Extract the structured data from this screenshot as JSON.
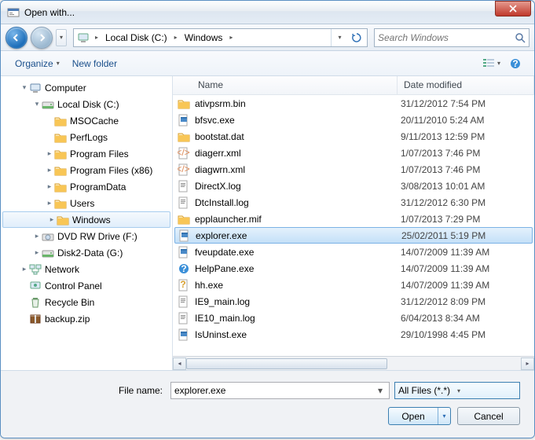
{
  "title": "Open with...",
  "breadcrumb": {
    "seg0": "Local Disk (C:)",
    "seg1": "Windows"
  },
  "search": {
    "placeholder": "Search Windows"
  },
  "toolbar": {
    "organize": "Organize",
    "newfolder": "New folder"
  },
  "tree": [
    {
      "depth": 1,
      "exp": "▾",
      "icon": "computer",
      "label": "Computer"
    },
    {
      "depth": 2,
      "exp": "▾",
      "icon": "drive",
      "label": "Local Disk (C:)"
    },
    {
      "depth": 3,
      "exp": "",
      "icon": "folder",
      "label": "MSOCache"
    },
    {
      "depth": 3,
      "exp": "",
      "icon": "folder",
      "label": "PerfLogs"
    },
    {
      "depth": 3,
      "exp": "▸",
      "icon": "folder",
      "label": "Program Files"
    },
    {
      "depth": 3,
      "exp": "▸",
      "icon": "folder",
      "label": "Program Files (x86)"
    },
    {
      "depth": 3,
      "exp": "▸",
      "icon": "folder",
      "label": "ProgramData"
    },
    {
      "depth": 3,
      "exp": "▸",
      "icon": "folder",
      "label": "Users"
    },
    {
      "depth": 3,
      "exp": "▸",
      "icon": "folder",
      "label": "Windows",
      "selected": true
    },
    {
      "depth": 2,
      "exp": "▸",
      "icon": "dvd",
      "label": "DVD RW Drive (F:)"
    },
    {
      "depth": 2,
      "exp": "▸",
      "icon": "drive",
      "label": "Disk2-Data (G:)"
    },
    {
      "depth": 1,
      "exp": "▸",
      "icon": "network",
      "label": "Network"
    },
    {
      "depth": 1,
      "exp": "",
      "icon": "control",
      "label": "Control Panel"
    },
    {
      "depth": 1,
      "exp": "",
      "icon": "recycle",
      "label": "Recycle Bin"
    },
    {
      "depth": 1,
      "exp": "",
      "icon": "zip",
      "label": "backup.zip"
    }
  ],
  "columns": {
    "name": "Name",
    "date": "Date modified"
  },
  "files": [
    {
      "icon": "file",
      "name": "ativpsrm.bin",
      "date": "31/12/2012 7:54 PM"
    },
    {
      "icon": "exe",
      "name": "bfsvc.exe",
      "date": "20/11/2010 5:24 AM"
    },
    {
      "icon": "file",
      "name": "bootstat.dat",
      "date": "9/11/2013 12:59 PM"
    },
    {
      "icon": "xml",
      "name": "diagerr.xml",
      "date": "1/07/2013 7:46 PM"
    },
    {
      "icon": "xml",
      "name": "diagwrn.xml",
      "date": "1/07/2013 7:46 PM"
    },
    {
      "icon": "log",
      "name": "DirectX.log",
      "date": "3/08/2013 10:01 AM"
    },
    {
      "icon": "log",
      "name": "DtcInstall.log",
      "date": "31/12/2012 6:30 PM"
    },
    {
      "icon": "file",
      "name": "epplauncher.mif",
      "date": "1/07/2013 7:29 PM"
    },
    {
      "icon": "exe",
      "name": "explorer.exe",
      "date": "25/02/2011 5:19 PM",
      "selected": true
    },
    {
      "icon": "exe",
      "name": "fveupdate.exe",
      "date": "14/07/2009 11:39 AM"
    },
    {
      "icon": "help",
      "name": "HelpPane.exe",
      "date": "14/07/2009 11:39 AM"
    },
    {
      "icon": "hh",
      "name": "hh.exe",
      "date": "14/07/2009 11:39 AM"
    },
    {
      "icon": "log",
      "name": "IE9_main.log",
      "date": "31/12/2012 8:09 PM"
    },
    {
      "icon": "log",
      "name": "IE10_main.log",
      "date": "6/04/2013 8:34 AM"
    },
    {
      "icon": "exe",
      "name": "IsUninst.exe",
      "date": "29/10/1998 4:45 PM"
    }
  ],
  "filename": {
    "label": "File name:",
    "value": "explorer.exe"
  },
  "filter": "All Files (*.*)",
  "buttons": {
    "open": "Open",
    "cancel": "Cancel"
  }
}
